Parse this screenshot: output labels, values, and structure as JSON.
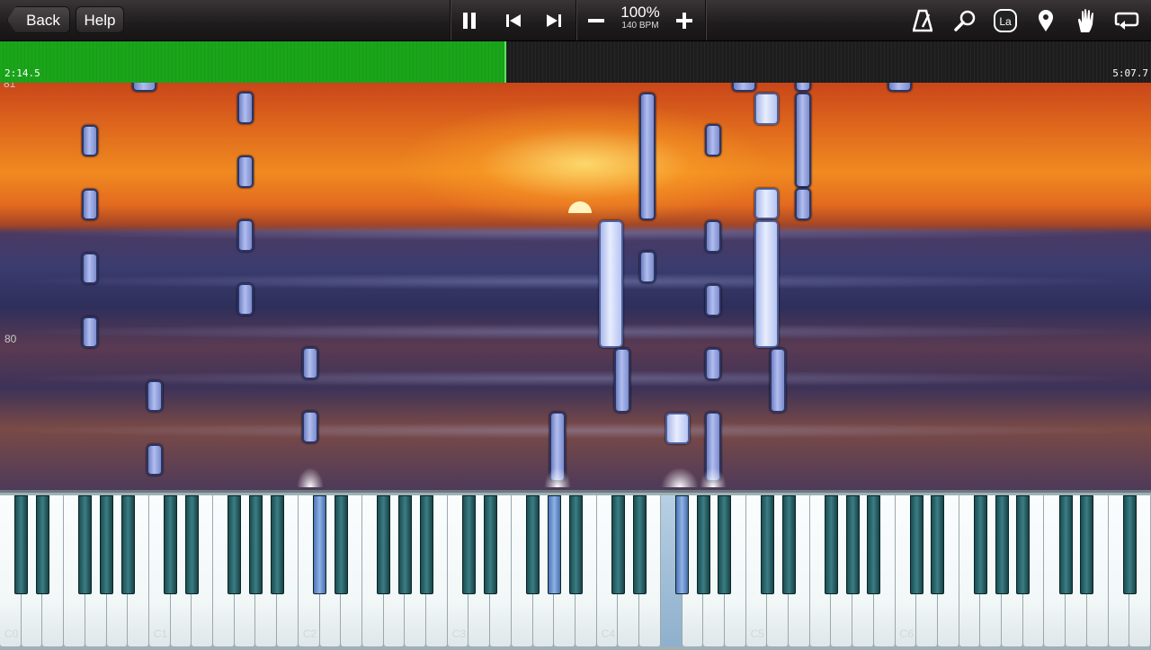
{
  "toolbar": {
    "back_label": "Back",
    "help_label": "Help",
    "tempo_percent": "100%",
    "tempo_bpm": "140 BPM",
    "icons": [
      "pause-icon",
      "previous-icon",
      "next-icon",
      "minus-icon",
      "plus-icon",
      "metronome-icon",
      "magnifier-icon",
      "note-label-icon",
      "marker-icon",
      "hand-icon",
      "loop-icon"
    ],
    "note_label_text": "La"
  },
  "progress": {
    "current_time": "2:14.5",
    "total_time": "5:07.7",
    "fraction": 0.438,
    "fill_color": "#1a9f1a"
  },
  "roll": {
    "measure_labels": [
      "81",
      "80"
    ],
    "note_color": "#9aa9e0"
  },
  "keyboard": {
    "octave_labels": [
      "C0",
      "C1",
      "C2",
      "C3",
      "C4",
      "C5",
      "C6"
    ],
    "highlight_color": "#8fb2e6"
  }
}
